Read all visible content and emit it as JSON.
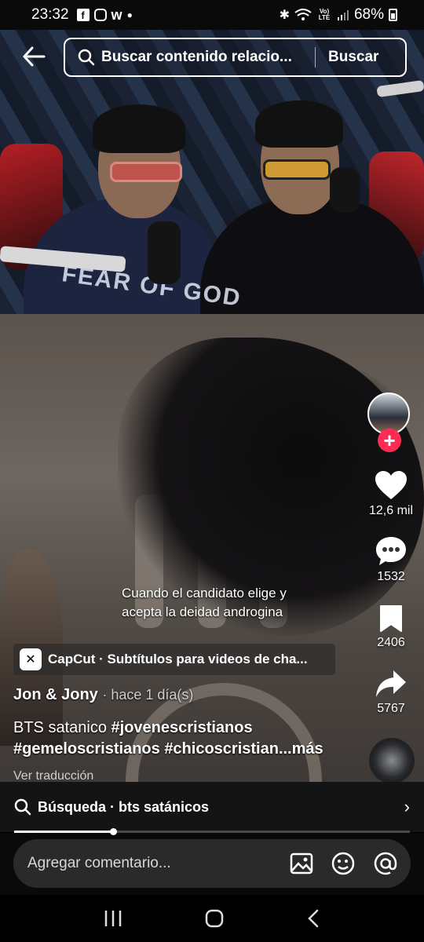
{
  "status_bar": {
    "time": "23:32",
    "app_icons": [
      "facebook-icon",
      "instagram-icon",
      "wattpad-icon"
    ],
    "battery": "68%",
    "signal_label": "Vo) LTE"
  },
  "header": {
    "search_placeholder": "Buscar contenido relacio...",
    "search_button": "Buscar"
  },
  "video": {
    "shirt_text": "FEAR OF GOD",
    "subtitle_line1": "Cuando el candidato elige y",
    "subtitle_line2": "acepta la deidad androgina"
  },
  "actions": {
    "likes": "12,6 mil",
    "comments": "1532",
    "saves": "2406",
    "shares": "5767"
  },
  "capcut": {
    "label": "CapCut · Subtítulos para videos de cha..."
  },
  "post": {
    "author": "Jon & Jony",
    "time_ago": "· hace 1 día(s)",
    "caption_text": "BTS satanico",
    "tag1": "#jovenescristianos",
    "tag2": "#gemeloscristianos",
    "tag3": "#chicoscristian...",
    "more": "más",
    "translate": "Ver traducción"
  },
  "search_suggestion": {
    "label": "Búsqueda · bts satánicos"
  },
  "playback": {
    "progress_fraction": 0.25
  },
  "comment_bar": {
    "placeholder": "Agregar comentario..."
  },
  "colors": {
    "accent_red": "#fe2c55",
    "bar_bg": "#141414",
    "input_bg": "#2a2a2a"
  }
}
